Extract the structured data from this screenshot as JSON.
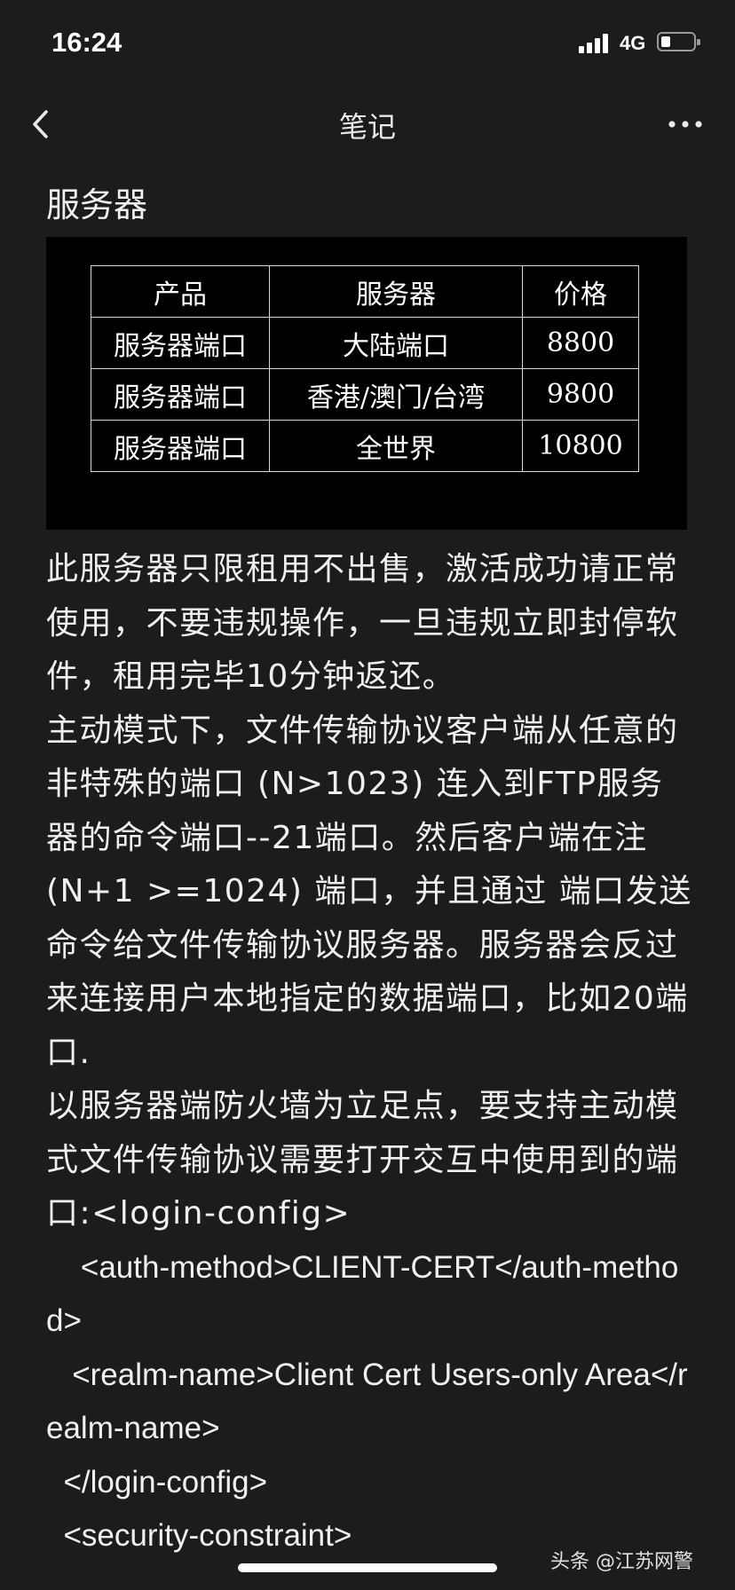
{
  "status_bar": {
    "time": "16:24",
    "network": "4G",
    "battery_level": 0.3,
    "signal_bars": 4
  },
  "nav": {
    "title": "笔记",
    "back_icon": "chevron-left-icon",
    "more_icon": "ellipsis-icon"
  },
  "note": {
    "section_title": "服务器",
    "table": {
      "headers": [
        "产品",
        "服务器",
        "价格"
      ],
      "rows": [
        [
          "服务器端口",
          "大陆端口",
          "8800"
        ],
        [
          "服务器端口",
          "香港/澳门/台湾",
          "9800"
        ],
        [
          "服务器端口",
          "全世界",
          "10800"
        ]
      ]
    },
    "paragraphs": [
      "此服务器只限租用不出售，激活成功请正常使用，不要违规操作，一旦违规立即封停软件，租用完毕10分钟返还。",
      "主动模式下，文件传输协议客户端从任意的非特殊的端口 (N>1023) 连入到FTP服务器的命令端口--21端口。然后客户端在注 (N+1 >=1024) 端口，并且通过 端口发送命令给文件传输协议服务器。服务器会反过来连接用户本地指定的数据端口，比如20端口.",
      "以服务器端防火墙为立足点，要支持主动模式文件传输协议需要打开交互中使用到的端口:<login-config>"
    ],
    "code_lines": [
      "    <auth-method>CLIENT-CERT</auth-method>",
      "   <realm-name>Client Cert Users-only Area</realm-name>",
      "  </login-config>",
      "  <security-constraint>"
    ]
  },
  "watermark": "头条 @江苏网警",
  "colors": {
    "background": "#1c1c1e",
    "text": "#f0f0f0",
    "table_background": "#000000"
  }
}
